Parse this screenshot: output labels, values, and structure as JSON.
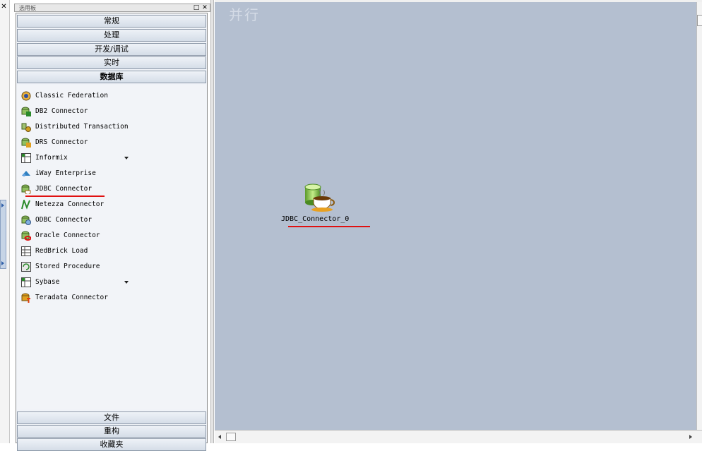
{
  "palette": {
    "title": "选用板",
    "categories_top": [
      "常规",
      "处理",
      "开发/调试",
      "实时",
      "数据库"
    ],
    "active_category": "数据库",
    "items": [
      {
        "label": "Classic Federation",
        "icon": "classic-federation-icon",
        "dropdown": false
      },
      {
        "label": "DB2 Connector",
        "icon": "db2-connector-icon",
        "dropdown": false
      },
      {
        "label": "Distributed Transaction",
        "icon": "distributed-transaction-icon",
        "dropdown": false
      },
      {
        "label": "DRS Connector",
        "icon": "drs-connector-icon",
        "dropdown": false
      },
      {
        "label": "Informix",
        "icon": "informix-icon",
        "dropdown": true
      },
      {
        "label": "iWay Enterprise",
        "icon": "iway-enterprise-icon",
        "dropdown": false
      },
      {
        "label": "JDBC Connector",
        "icon": "jdbc-connector-icon",
        "dropdown": false
      },
      {
        "label": "Netezza Connector",
        "icon": "netezza-connector-icon",
        "dropdown": false
      },
      {
        "label": "ODBC Connector",
        "icon": "odbc-connector-icon",
        "dropdown": false
      },
      {
        "label": "Oracle Connector",
        "icon": "oracle-connector-icon",
        "dropdown": false
      },
      {
        "label": "RedBrick Load",
        "icon": "redbrick-load-icon",
        "dropdown": false
      },
      {
        "label": "Stored Procedure",
        "icon": "stored-procedure-icon",
        "dropdown": false
      },
      {
        "label": "Sybase",
        "icon": "sybase-icon",
        "dropdown": true
      },
      {
        "label": "Teradata Connector",
        "icon": "teradata-connector-icon",
        "dropdown": false
      }
    ],
    "categories_bottom": [
      "文件",
      "重构",
      "收藏夹"
    ]
  },
  "canvas": {
    "title": "并行",
    "stage": {
      "label": "JDBC_Connector_0",
      "icon": "jdbc-connector-stage-icon"
    }
  },
  "colors": {
    "canvas_bg": "#b4bfd0",
    "highlight_underline": "#e01010"
  }
}
